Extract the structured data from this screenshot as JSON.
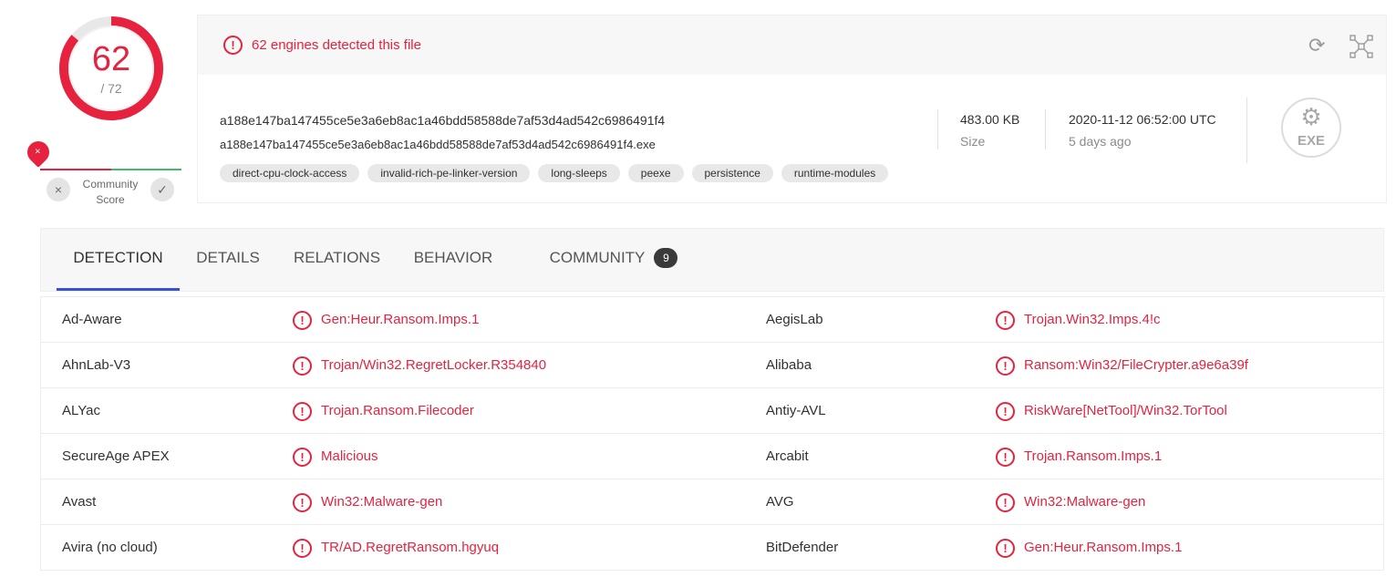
{
  "score": {
    "detected": "62",
    "total": "/ 72",
    "detected_fraction": 0.861,
    "ring_color": "#e6223f"
  },
  "community": {
    "label": "Community Score",
    "pin_glyph": "×",
    "down_glyph": "×",
    "up_glyph": "✓"
  },
  "header": {
    "alert_icon": "!",
    "alert_text": "62 engines detected this file",
    "reload_icon": "⟳",
    "hash": "a188e147ba147455ce5e3a6eb8ac1a46bdd58588de7af53d4ad542c6986491f4",
    "filename": "a188e147ba147455ce5e3a6eb8ac1a46bdd58588de7af53d4ad542c6986491f4.exe",
    "tags": [
      "direct-cpu-clock-access",
      "invalid-rich-pe-linker-version",
      "long-sleeps",
      "peexe",
      "persistence",
      "runtime-modules"
    ],
    "size_value": "483.00 KB",
    "size_label": "Size",
    "date_value": "2020-11-12 06:52:00 UTC",
    "date_label": "5 days ago",
    "filetype": "EXE",
    "filetype_glyph": "⚙"
  },
  "tabs": [
    {
      "label": "DETECTION"
    },
    {
      "label": "DETAILS"
    },
    {
      "label": "RELATIONS"
    },
    {
      "label": "BEHAVIOR"
    },
    {
      "label": "COMMUNITY",
      "badge": "9"
    }
  ],
  "detections": [
    {
      "left_engine": "Ad-Aware",
      "left_result": "Gen:Heur.Ransom.Imps.1",
      "right_engine": "AegisLab",
      "right_result": "Trojan.Win32.Imps.4!c"
    },
    {
      "left_engine": "AhnLab-V3",
      "left_result": "Trojan/Win32.RegretLocker.R354840",
      "right_engine": "Alibaba",
      "right_result": "Ransom:Win32/FileCrypter.a9e6a39f"
    },
    {
      "left_engine": "ALYac",
      "left_result": "Trojan.Ransom.Filecoder",
      "right_engine": "Antiy-AVL",
      "right_result": "RiskWare[NetTool]/Win32.TorTool"
    },
    {
      "left_engine": "SecureAge APEX",
      "left_result": "Malicious",
      "right_engine": "Arcabit",
      "right_result": "Trojan.Ransom.Imps.1"
    },
    {
      "left_engine": "Avast",
      "left_result": "Win32:Malware-gen",
      "right_engine": "AVG",
      "right_result": "Win32:Malware-gen"
    },
    {
      "left_engine": "Avira (no cloud)",
      "left_result": "TR/AD.RegretRansom.hgyuq",
      "right_engine": "BitDefender",
      "right_result": "Gen:Heur.Ransom.Imps.1"
    }
  ]
}
